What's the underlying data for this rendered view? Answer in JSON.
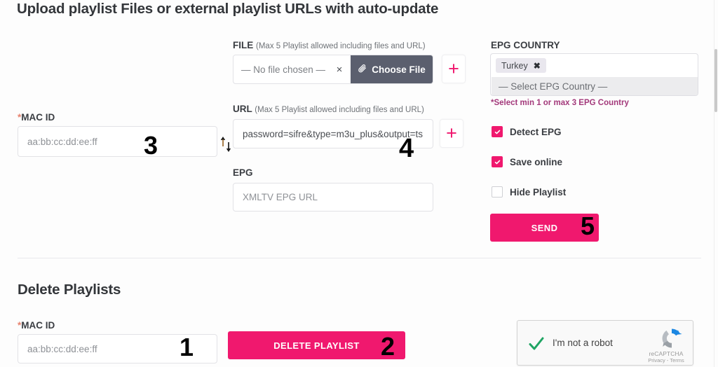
{
  "upload_section": {
    "title": "Upload playlist Files or external playlist URLs with auto-update",
    "mac_id": {
      "label_star": "*",
      "label": "MAC ID",
      "placeholder": "aa:bb:cc:dd:ee:ff",
      "value": ""
    },
    "file": {
      "label": "FILE",
      "hint": "(Max 5 Playlist allowed including files and URL)",
      "no_file_text": "— No file chosen —",
      "clear_icon": "×",
      "choose_button": "Choose File",
      "attach_icon": "paperclip-icon",
      "add_icon": "+"
    },
    "url": {
      "label": "URL",
      "hint": "(Max 5 Playlist allowed including files and URL)",
      "value": "password=sifre&type=m3u_plus&output=ts",
      "add_icon": "+"
    },
    "epg": {
      "label": "EPG",
      "placeholder": "XMLTV EPG URL",
      "value": ""
    },
    "swap_icon": "up-down-arrows-icon",
    "epg_country": {
      "label": "EPG COUNTRY",
      "selected_chips": [
        {
          "label": "Turkey",
          "remove_icon": "✖"
        }
      ],
      "placeholder": "— Select EPG Country —",
      "note": "*Select min 1 or max 3 EPG Country"
    },
    "options": [
      {
        "label": "Detect EPG",
        "checked": true
      },
      {
        "label": "Save online",
        "checked": true
      },
      {
        "label": "Hide Playlist",
        "checked": false
      }
    ],
    "send_button": "SEND"
  },
  "delete_section": {
    "title": "Delete Playlists",
    "mac_id": {
      "label_star": "*",
      "label": "MAC ID",
      "placeholder": "aa:bb:cc:dd:ee:ff",
      "value": ""
    },
    "delete_button": "DELETE PLAYLIST"
  },
  "recaptcha": {
    "label": "I'm not a robot",
    "brand": "reCAPTCHA",
    "legal": "Privacy - Terms",
    "checked": true
  },
  "steps": {
    "one": "1",
    "two": "2",
    "three": "3",
    "four": "4",
    "five": "5"
  },
  "colors": {
    "accent_pink": "#f0186e",
    "choose_file_gray": "#5b5f6e",
    "note_purple": "#a3397b",
    "required_star": "#e8836f"
  }
}
